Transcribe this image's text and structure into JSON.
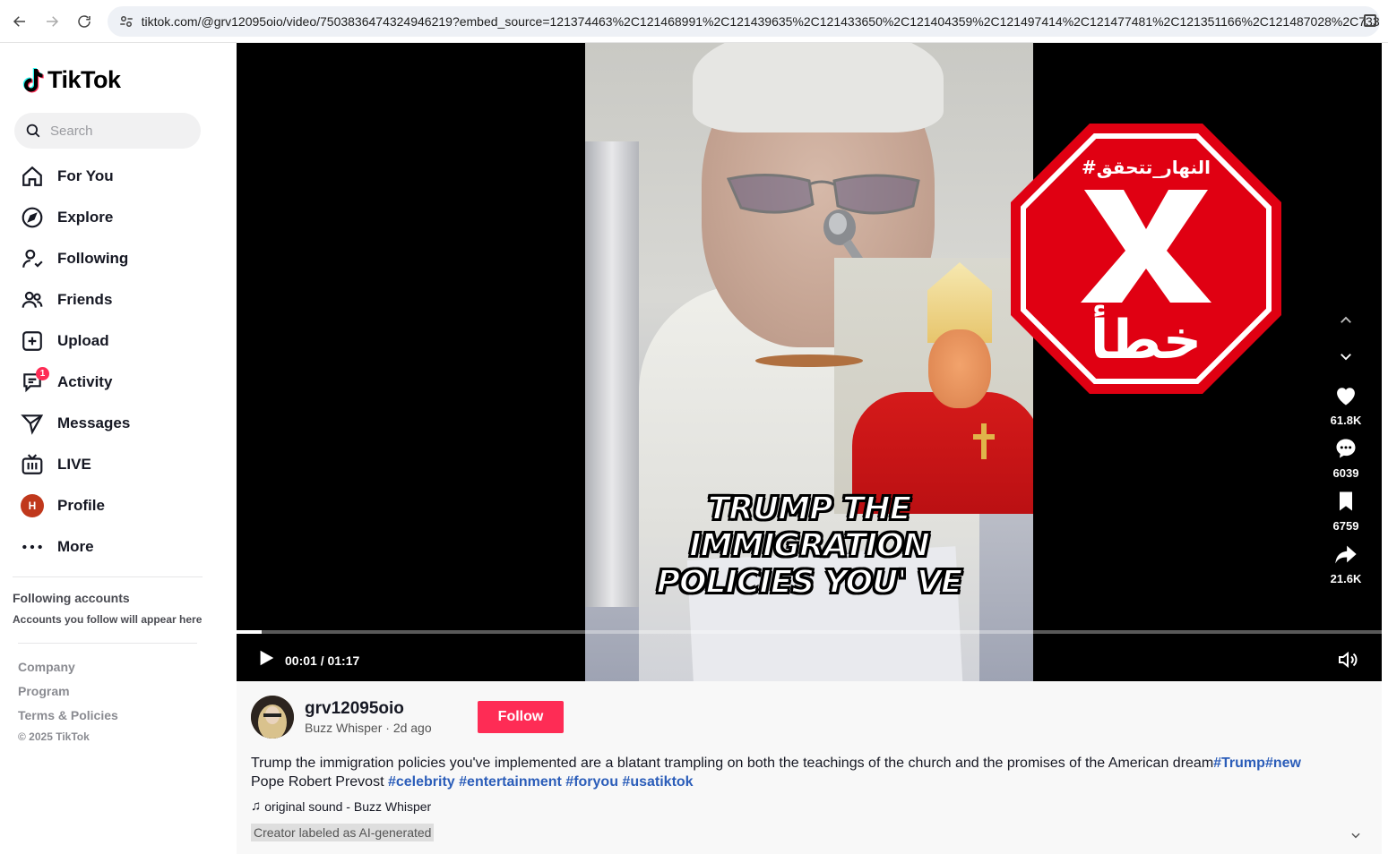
{
  "browser": {
    "url": "tiktok.com/@grv12095oio/video/7503836474324946219?embed_source=121374463%2C121468991%2C121439635%2C121433650%2C121404359%2C121497414%2C121477481%2C121351166%2C121487028%2C73347..."
  },
  "sidebar": {
    "logo_text": "TikTok",
    "search_placeholder": "Search",
    "items": [
      {
        "label": "For You",
        "icon": "home-icon"
      },
      {
        "label": "Explore",
        "icon": "compass-icon"
      },
      {
        "label": "Following",
        "icon": "following-icon"
      },
      {
        "label": "Friends",
        "icon": "friends-icon"
      },
      {
        "label": "Upload",
        "icon": "upload-icon"
      },
      {
        "label": "Activity",
        "icon": "activity-icon",
        "badge": "1"
      },
      {
        "label": "Messages",
        "icon": "messages-icon"
      },
      {
        "label": "LIVE",
        "icon": "live-icon"
      },
      {
        "label": "Profile",
        "icon": "profile-avatar",
        "avatar_letter": "H"
      },
      {
        "label": "More",
        "icon": "more-icon"
      }
    ],
    "following_title": "Following accounts",
    "following_subtitle": "Accounts you follow will appear here",
    "footer": {
      "links": [
        "Company",
        "Program",
        "Terms & Policies"
      ],
      "copyright": "© 2025 TikTok"
    }
  },
  "video": {
    "caption_lines": [
      "TRUMP THE",
      "IMMIGRATION",
      "POLICIES YOU' VE"
    ],
    "stamp_top_text": "#النهار_تتحقق",
    "stamp_bottom_text": "خطأ",
    "stamp_color": "#e00012",
    "progress_fraction": 0.022,
    "time": "00:01 / 01:17",
    "actions": [
      {
        "name": "like",
        "icon": "heart-icon",
        "count": "61.8K"
      },
      {
        "name": "comment",
        "icon": "comment-icon",
        "count": "6039"
      },
      {
        "name": "save",
        "icon": "bookmark-icon",
        "count": "6759"
      },
      {
        "name": "share",
        "icon": "share-icon",
        "count": "21.6K"
      }
    ]
  },
  "post": {
    "username": "grv12095oio",
    "display_name": "Buzz Whisper",
    "posted": "2d ago",
    "follow_label": "Follow",
    "description_text": "Trump the immigration policies you've implemented are a blatant trampling on both the teachings of the church and the promises of the American dream",
    "description_line2": "Pope Robert Prevost ",
    "hashtags_line1": [
      "#Trump",
      "#new"
    ],
    "hashtags_line2": [
      "#celebrity",
      "#entertainment",
      "#foryou",
      "#usatiktok"
    ],
    "sound": "original sound - Buzz Whisper",
    "ai_label": "Creator labeled as AI-generated"
  },
  "colors": {
    "accent": "#fe2c55",
    "hashtag": "#2b5db9"
  }
}
